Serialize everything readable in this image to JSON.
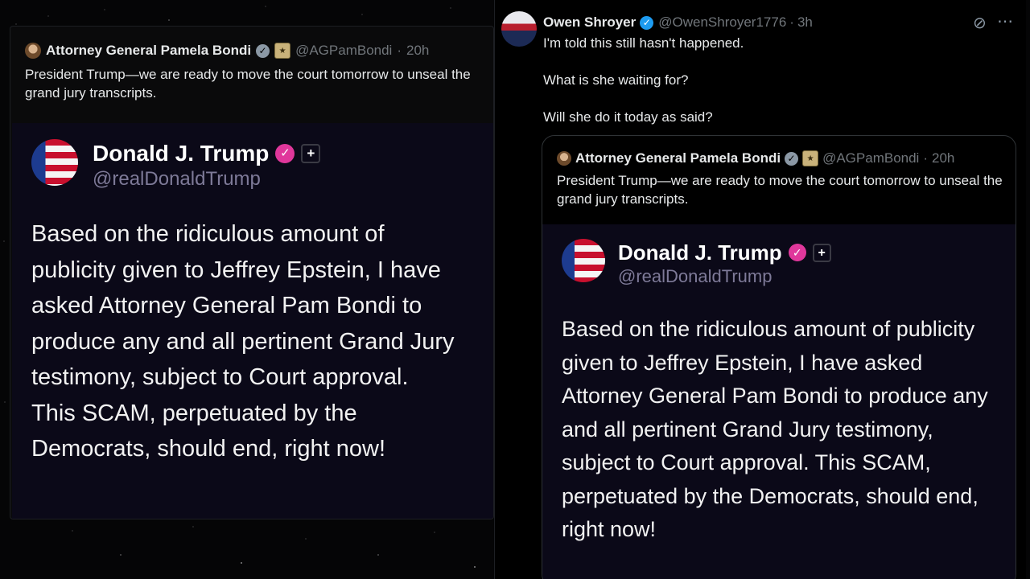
{
  "quoted_tweet": {
    "author_name": "Attorney General Pamela Bondi",
    "handle": "@AGPamBondi",
    "separator": "·",
    "time": "20h",
    "text": "President Trump—we are ready to move the court tomorrow to unseal the grand jury transcripts."
  },
  "truth_post": {
    "name": "Donald J. Trump",
    "handle": "@realDonaldTrump",
    "plus_symbol": "+",
    "body": "Based on the ridiculous amount of publicity given to Jeffrey Epstein, I have asked Attorney General Pam Bondi to produce any and all pertinent Grand Jury testimony, subject to Court approval. This SCAM, perpetuated by the Democrats, should end, right now!"
  },
  "main_post": {
    "author_name": "Owen Shroyer",
    "handle": "@OwenShroyer1776",
    "separator": "·",
    "time": "3h",
    "line1": "I'm told this still hasn't happened.",
    "line2": "What is she waiting for?",
    "line3": "Will she do it today as said?"
  },
  "icons": {
    "verified_gray": "verified-gray-icon",
    "verified_blue": "verified-blue-icon",
    "gov_seal": "government-seal-icon",
    "grok": "grok-icon",
    "more": "more-options-icon"
  },
  "colors": {
    "x_blue": "#1d9bf0",
    "truth_pink": "#e0379b",
    "truth_card_bg": "#0b0918"
  }
}
